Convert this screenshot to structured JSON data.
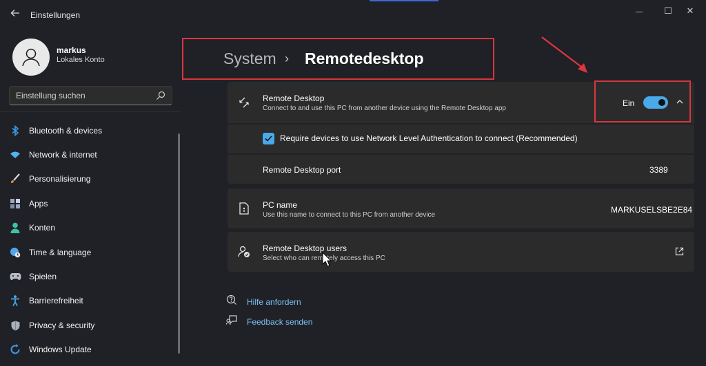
{
  "window": {
    "title": "Einstellungen",
    "back_icon": "arrow-left-icon",
    "minimize_glyph": "—",
    "maximize_glyph": "☐",
    "close_glyph": "✕"
  },
  "user": {
    "name": "markus",
    "account": "Lokales Konto"
  },
  "search": {
    "placeholder": "Einstellung suchen"
  },
  "nav": [
    {
      "label": "Bluetooth & devices",
      "icon": "bluetooth-icon",
      "color": "#3b9ae8"
    },
    {
      "label": "Network & internet",
      "icon": "wifi-icon",
      "color": "#4fb4ef"
    },
    {
      "label": "Personalisierung",
      "icon": "brush-icon",
      "color": "#e69b4b"
    },
    {
      "label": "Apps",
      "icon": "apps-icon",
      "color": "#9aa6c3"
    },
    {
      "label": "Konten",
      "icon": "person-icon",
      "color": "#3fc1a8"
    },
    {
      "label": "Time & language",
      "icon": "globe-clock-icon",
      "color": "#4fa8ee"
    },
    {
      "label": "Spielen",
      "icon": "gamepad-icon",
      "color": "#b9bfc9"
    },
    {
      "label": "Barrierefreiheit",
      "icon": "accessibility-icon",
      "color": "#4aa9e8"
    },
    {
      "label": "Privacy & security",
      "icon": "shield-icon",
      "color": "#a8b0bd"
    },
    {
      "label": "Windows Update",
      "icon": "update-icon",
      "color": "#3b9ae8"
    }
  ],
  "breadcrumb": {
    "parent": "System",
    "separator": "›",
    "current": "Remotedesktop"
  },
  "remote_desktop": {
    "title": "Remote Desktop",
    "subtitle": "Connect to and use this PC from another device using the Remote Desktop app",
    "toggle_state_label": "Ein",
    "toggle_on": true,
    "nla_label": "Require devices to use Network Level Authentication to connect (Recommended)",
    "nla_checked": true,
    "port_label": "Remote Desktop port",
    "port_value": "3389"
  },
  "pc_name": {
    "title": "PC name",
    "subtitle": "Use this name to connect to this PC from another device",
    "value": "MARKUSELSBE2E84"
  },
  "rd_users": {
    "title": "Remote Desktop users",
    "subtitle": "Select who can remotely access this PC"
  },
  "links": {
    "help": "Hilfe anfordern",
    "feedback": "Feedback senden"
  },
  "colors": {
    "accent": "#4aa9e8",
    "highlight_box": "#d9363e",
    "background": "#202127",
    "card": "#2b2b2b"
  }
}
